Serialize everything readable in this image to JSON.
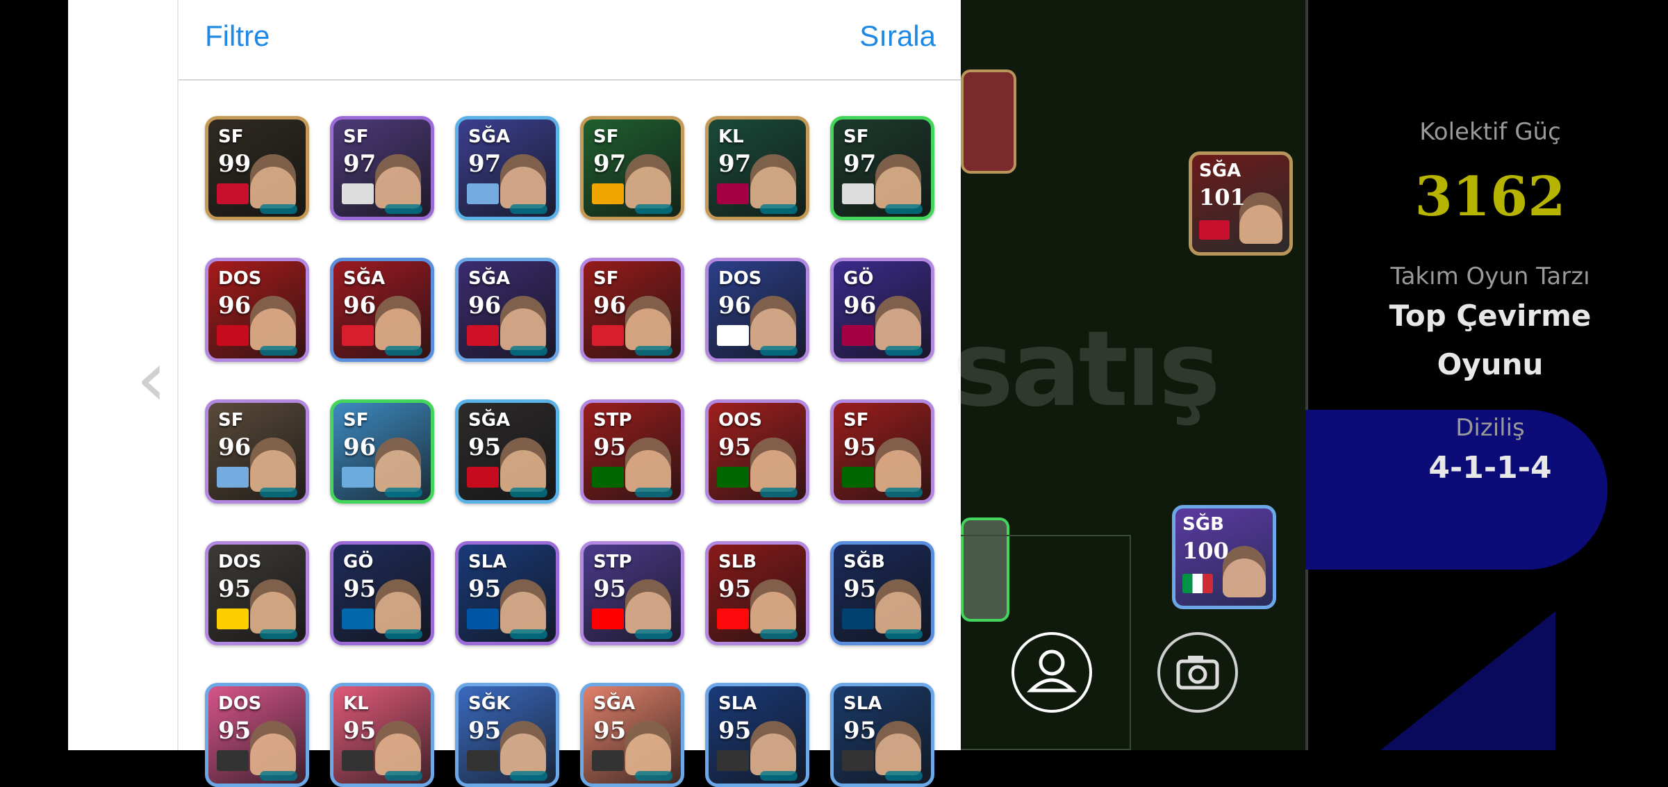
{
  "header": {
    "filter_label": "Filtre",
    "sort_label": "Sırala"
  },
  "cards": [
    {
      "pos": "SF",
      "rating": "99",
      "border": "#c49a56",
      "bg": "#2f2a22",
      "flag": "#c8102e"
    },
    {
      "pos": "SF",
      "rating": "97",
      "border": "#9c6bd8",
      "bg": "#4c3a78",
      "flag": "#ddd"
    },
    {
      "pos": "SĞA",
      "rating": "97",
      "border": "#5ab2e8",
      "bg": "#3b3f8f",
      "flag": "#74acdf"
    },
    {
      "pos": "SF",
      "rating": "97",
      "border": "#c49a56",
      "bg": "#1f5f2f",
      "flag": "#f0a500"
    },
    {
      "pos": "KL",
      "rating": "97",
      "border": "#c49a56",
      "bg": "#1a4a3a",
      "flag": "#a50044"
    },
    {
      "pos": "SF",
      "rating": "97",
      "border": "#44d65a",
      "bg": "#1c3a2c",
      "flag": "#ddd"
    },
    {
      "pos": "DOS",
      "rating": "96",
      "border": "#b388e0",
      "bg": "#a71b1b",
      "flag": "#c60b1e"
    },
    {
      "pos": "SĞA",
      "rating": "96",
      "border": "#5a8fe0",
      "bg": "#9b1a22",
      "flag": "#d81e2c"
    },
    {
      "pos": "SĞA",
      "rating": "96",
      "border": "#6ca7e8",
      "bg": "#3b2c6f",
      "flag": "#ce1126"
    },
    {
      "pos": "SF",
      "rating": "96",
      "border": "#b388e0",
      "bg": "#951b1b",
      "flag": "#d81e2c"
    },
    {
      "pos": "DOS",
      "rating": "96",
      "border": "#b388e0",
      "bg": "#2c3f8a",
      "flag": "#ffffff"
    },
    {
      "pos": "GÖ",
      "rating": "96",
      "border": "#b388e0",
      "bg": "#3a2b8a",
      "flag": "#a50044"
    },
    {
      "pos": "SF",
      "rating": "96",
      "border": "#b388e0",
      "bg": "#5a4a3a",
      "flag": "#74acdf"
    },
    {
      "pos": "SF",
      "rating": "96",
      "border": "#44d65a",
      "bg": "#3d8ac0",
      "flag": "#6cabdd"
    },
    {
      "pos": "SĞA",
      "rating": "95",
      "border": "#5ab2e8",
      "bg": "#2d2a2a",
      "flag": "#c60b1e"
    },
    {
      "pos": "STP",
      "rating": "95",
      "border": "#b388e0",
      "bg": "#9a1d1d",
      "flag": "#006600"
    },
    {
      "pos": "OOS",
      "rating": "95",
      "border": "#b388e0",
      "bg": "#a01f1f",
      "flag": "#006600"
    },
    {
      "pos": "SF",
      "rating": "95",
      "border": "#b388e0",
      "bg": "#9a1d1d",
      "flag": "#006600"
    },
    {
      "pos": "DOS",
      "rating": "95",
      "border": "#b388e0",
      "bg": "#3d3a36",
      "flag": "#ffce00"
    },
    {
      "pos": "GÖ",
      "rating": "95",
      "border": "#9c6bd8",
      "bg": "#1f2c5a",
      "flag": "#0068a8"
    },
    {
      "pos": "SLA",
      "rating": "95",
      "border": "#9c6bd8",
      "bg": "#1a3a7a",
      "flag": "#0055a4"
    },
    {
      "pos": "STP",
      "rating": "95",
      "border": "#b388e0",
      "bg": "#4a3a8a",
      "flag": "#ff0000"
    },
    {
      "pos": "SLB",
      "rating": "95",
      "border": "#b388e0",
      "bg": "#8a1a1a",
      "flag": "#fb090b"
    },
    {
      "pos": "SĞB",
      "rating": "95",
      "border": "#5a8fe0",
      "bg": "#1a2a5a",
      "flag": "#004170"
    },
    {
      "pos": "DOS",
      "rating": "95",
      "border": "#6ca7e8",
      "bg": "#d6558a",
      "flag": "#333"
    },
    {
      "pos": "KL",
      "rating": "95",
      "border": "#6ca7e8",
      "bg": "#e05a7a",
      "flag": "#333"
    },
    {
      "pos": "SĞK",
      "rating": "95",
      "border": "#6ca7e8",
      "bg": "#3a6ac0",
      "flag": "#333"
    },
    {
      "pos": "SĞA",
      "rating": "95",
      "border": "#6ca7e8",
      "bg": "#e0806a",
      "flag": "#333"
    },
    {
      "pos": "SLA",
      "rating": "95",
      "border": "#6ca7e8",
      "bg": "#1a3a7a",
      "flag": "#333"
    },
    {
      "pos": "SLA",
      "rating": "95",
      "border": "#6ca7e8",
      "bg": "#1a3a6a",
      "flag": "#333"
    }
  ],
  "field_cards": [
    {
      "pos": "SĞA",
      "rating": "101",
      "flag": "#c8102e"
    },
    {
      "pos": "SĞB",
      "rating": "100",
      "flag": "#009246"
    }
  ],
  "watermark": "satış",
  "team": {
    "strength_label": "Kolektif Güç",
    "strength_value": "3162",
    "style_label": "Takım Oyun Tarzı",
    "style_value_line1": "Top Çevirme",
    "style_value_line2": "Oyunu",
    "formation_label": "Diziliş",
    "formation_value": "4-1-1-4"
  },
  "icons": [
    "back-arrow-icon",
    "profile-icon",
    "camera-icon"
  ],
  "colors": {
    "accent": "#1e88e5",
    "strength": "#b7b400"
  }
}
